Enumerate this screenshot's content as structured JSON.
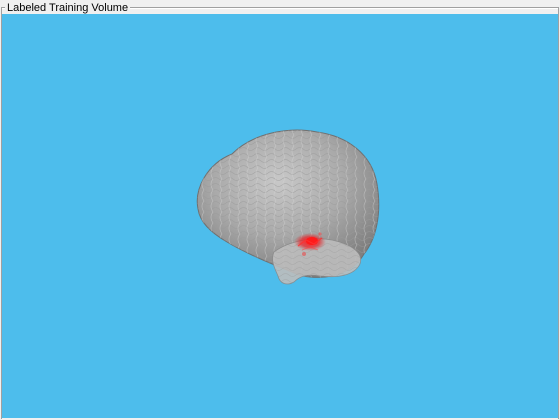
{
  "panel": {
    "title": "Labeled Training Volume"
  },
  "viewport": {
    "background_color": "#4dbdec",
    "volume_color": "#b0b0b0",
    "label_color": "#e8242a"
  }
}
